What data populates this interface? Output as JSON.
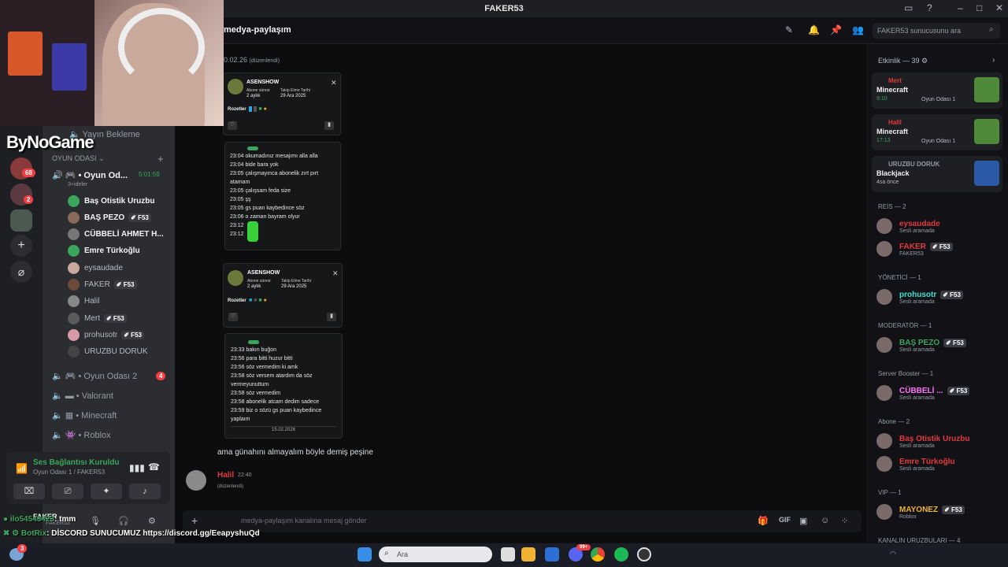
{
  "window": {
    "title": "FAKER53"
  },
  "server": {
    "name": "FAKER53",
    "search_placeholder": "FAKER53 sunucusunu ara"
  },
  "channel": {
    "name": "medya-paylaşım",
    "input_placeholder": "medya-paylaşım kanalına mesaj gönder"
  },
  "stream_overlay": {
    "brand": "ByNoGame"
  },
  "guilds": {
    "badge1": "68",
    "badge2": "2"
  },
  "channels": {
    "top_item": "Yayın Bekleme",
    "category": "OYUN ODASI",
    "room1": {
      "name": "Oyun Od...",
      "timer": "5:01:59",
      "sub": "3+ideler"
    },
    "members": [
      {
        "name": "Baş Otistik Uruzbu",
        "tag": ""
      },
      {
        "name": "BAŞ PEZO",
        "tag": "F53"
      },
      {
        "name": "CÜBBELİ AHMET H...",
        "tag": ""
      },
      {
        "name": "Emre Türkoğlu",
        "tag": ""
      },
      {
        "name": "eysaudade",
        "tag": ""
      },
      {
        "name": "FAKER",
        "tag": "F53"
      },
      {
        "name": "Halil",
        "tag": ""
      },
      {
        "name": "Mert",
        "tag": "F53"
      },
      {
        "name": "prohusotr",
        "tag": "F53"
      },
      {
        "name": "URUZBU DORUK",
        "tag": ""
      }
    ],
    "room2": {
      "name": "Oyun Odası 2",
      "badge": "4"
    },
    "others": [
      "Valorant",
      "Minecraft",
      "Roblox"
    ]
  },
  "voice": {
    "status": "Ses Bağlantısı Kuruldu",
    "location": "Oyun Odası 1 / FAKER53"
  },
  "user_panel": {
    "name": "FAKER",
    "server": "FAKER53"
  },
  "messages": {
    "date_partial": "0.02.26",
    "edited": "(düzenlendi)",
    "card1": {
      "user": "ASENSHOW",
      "sub_label": "Abone süresi:",
      "sub_value": "2 aylık",
      "follow_label": "Takip Etme Tarihi",
      "follow_value": "29 Ara 2025",
      "badges_label": "Rozetler",
      "lines": [
        {
          "t": "23:04",
          "m": "okumadınız mesajımı alla alla"
        },
        {
          "t": "23:04",
          "m": "bide bara yok"
        },
        {
          "t": "23:05",
          "m": "çalışmayınca abonelik zırt pırt atamam"
        },
        {
          "t": "23:05",
          "m": "çalışsam feda size"
        },
        {
          "t": "23:05",
          "m": "şş"
        },
        {
          "t": "23:05",
          "m": "gs puan kaybedince söz"
        },
        {
          "t": "23:06",
          "m": "o zaman bayram olyur"
        },
        {
          "t": "23:12",
          "m": ""
        },
        {
          "t": "23:12",
          "m": ""
        }
      ]
    },
    "card2": {
      "user": "ASENSHOW",
      "sub_label": "Abone süresi:",
      "sub_value": "2 aylık",
      "follow_label": "Takip Etme Tarihi",
      "follow_value": "29 Ara 2025",
      "badges_label": "Rozetler",
      "lines": [
        {
          "t": "23:33",
          "m": "bakın buğon"
        },
        {
          "t": "23:56",
          "m": "para bitti huzur bitti"
        },
        {
          "t": "23:56",
          "m": "söz vermedim ki amk"
        },
        {
          "t": "23:58",
          "m": "söz versem atardım da söz vermeyunuttum"
        },
        {
          "t": "23:58",
          "m": "söz vermedim"
        },
        {
          "t": "23:58",
          "m": "abonelik atcam dedim sadece"
        },
        {
          "t": "23:59",
          "m": "biz o sözü gs puan kaybedince yaplaım"
        }
      ],
      "footer_date": "15.02.2026"
    },
    "caption": "ama günahını almayalım böyle demiş peşine",
    "last": {
      "author": "Halil",
      "time": "22:40",
      "text": "(düzenlendi)"
    }
  },
  "activity": {
    "header": "Etkinlik — 39",
    "items": [
      {
        "user": "Mert",
        "game": "Minecraft",
        "time": "9:10",
        "room": "Oyun Odası 1"
      },
      {
        "user": "Halil",
        "game": "Minecraft",
        "time": "17:13",
        "room": "Oyun Odası 1"
      },
      {
        "user": "URUZBU DORUK",
        "game": "Blackjack",
        "time": "4sa önce",
        "room": ""
      }
    ]
  },
  "roles": [
    {
      "title": "REİS — 2",
      "members": [
        {
          "name": "eysaudade",
          "status": "Sesli aramada",
          "tag": ""
        },
        {
          "name": "FAKER",
          "status": "FAKER53",
          "tag": "F53"
        }
      ]
    },
    {
      "title": "YÖNETİCİ — 1",
      "members": [
        {
          "name": "prohusotr",
          "status": "Sesli aramada",
          "tag": "F53"
        }
      ]
    },
    {
      "title": "MODERATÖR — 1",
      "members": [
        {
          "name": "BAŞ PEZO",
          "status": "Sesli aramada",
          "tag": "F53"
        }
      ]
    },
    {
      "title": "Server Booster — 1",
      "members": [
        {
          "name": "CÜBBELİ ...",
          "status": "Sesli aramada",
          "tag": "F53"
        }
      ]
    },
    {
      "title": "Abone — 2",
      "members": [
        {
          "name": "Baş Otistik Uruzbu",
          "status": "Sesli aramada",
          "tag": ""
        },
        {
          "name": "Emre Türkoğlu",
          "status": "Sesli aramada",
          "tag": ""
        }
      ]
    },
    {
      "title": "VIP — 1",
      "members": [
        {
          "name": "MAYONEZ",
          "status": "Roblox",
          "tag": "F53"
        }
      ]
    },
    {
      "title": "KANALIN URUZBULARI — 4",
      "members": []
    }
  ],
  "stream_chat": [
    {
      "user": "ilo54543423",
      "text": ": tmm"
    },
    {
      "user": "BotRix",
      "text": ": DİSCORD SUNUCUMUZ https://discord.gg/EeapyshuQd"
    }
  ],
  "taskbar": {
    "search_placeholder": "Ara",
    "badge": "99+"
  },
  "colors": {
    "red_name": "#e03a3e",
    "green_name": "#3ba55d",
    "pink_name": "#ff73fa",
    "yellow_name": "#f0b232",
    "accent": "#5865f2"
  }
}
